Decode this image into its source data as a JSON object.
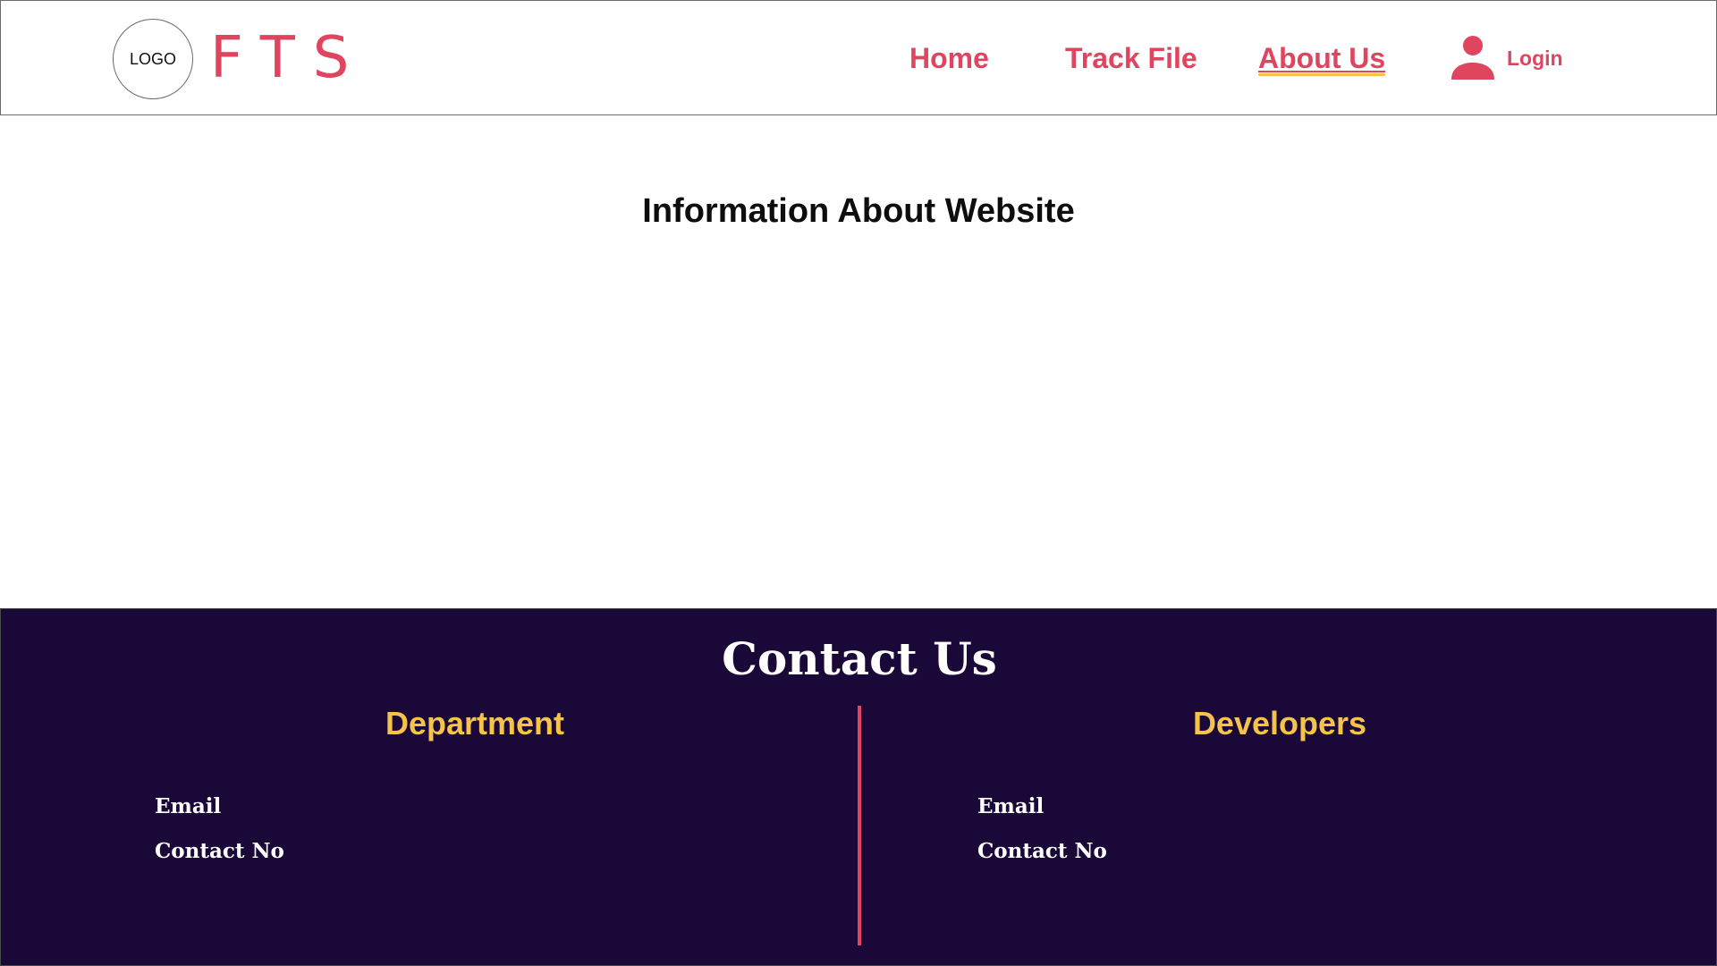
{
  "header": {
    "logo_text": "LOGO",
    "brand": "FTS",
    "nav": {
      "home": "Home",
      "track_file": "Track File",
      "about_us": "About Us"
    },
    "login_label": "Login",
    "active_nav": "About Us"
  },
  "main": {
    "title": "Information About Website"
  },
  "footer": {
    "title": "Contact Us",
    "department": {
      "heading": "Department",
      "email_label": "Email",
      "contact_label": "Contact No"
    },
    "developers": {
      "heading": "Developers",
      "email_label": "Email",
      "contact_label": "Contact No"
    }
  },
  "colors": {
    "accent": "#e0455f",
    "highlight": "#f6c34a",
    "footer_bg": "#190838"
  },
  "icons": {
    "user": "user-icon"
  }
}
